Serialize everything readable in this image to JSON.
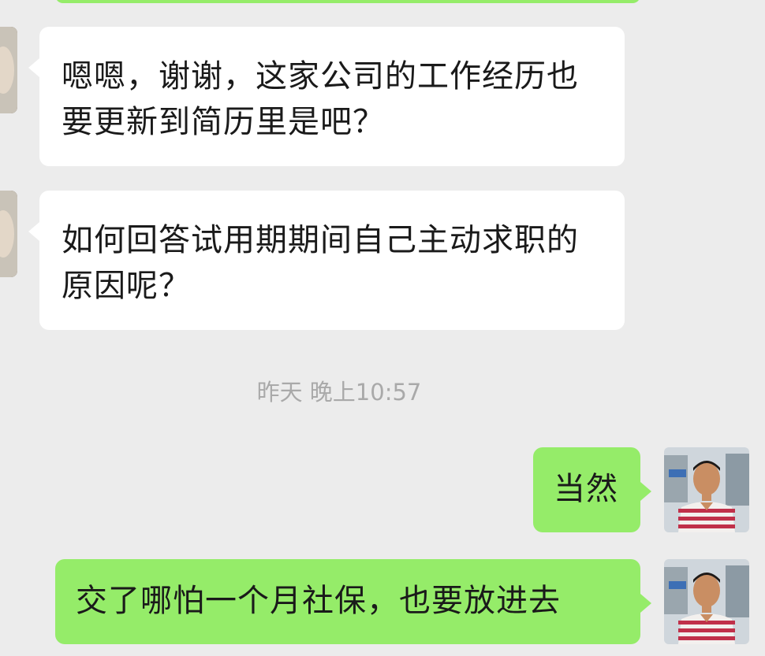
{
  "messages": [
    {
      "direction": "incoming",
      "text": "嗯嗯，谢谢，这家公司的工作经历也要更新到简历里是吧？"
    },
    {
      "direction": "incoming",
      "text": "如何回答试用期期间自己主动求职的原因呢？"
    },
    {
      "direction": "outgoing",
      "text": "当然"
    },
    {
      "direction": "outgoing",
      "text": "交了哪怕一个月社保，也要放进去"
    }
  ],
  "timestamp": "昨天 晚上10:57",
  "colors": {
    "background": "#ececec",
    "incoming_bubble": "#ffffff",
    "outgoing_bubble": "#95ec69",
    "timestamp_text": "#a9a9a9"
  },
  "icons": {
    "incoming_avatar": "contact-avatar-icon",
    "outgoing_avatar": "user-avatar-icon"
  }
}
